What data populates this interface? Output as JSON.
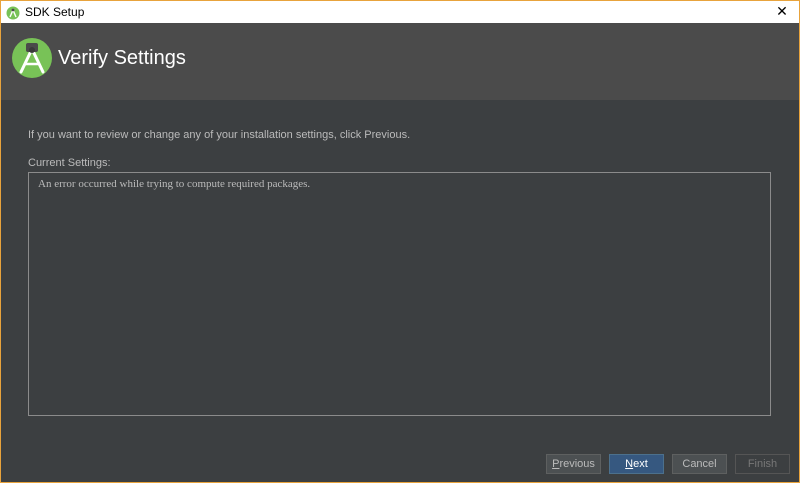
{
  "window": {
    "title": "SDK Setup",
    "close_glyph": "✕"
  },
  "header": {
    "heading": "Verify Settings"
  },
  "main": {
    "instructions": "If you want to review or change any of your installation settings, click Previous.",
    "settings_label": "Current Settings:",
    "settings_text": "An error occurred while trying to compute required packages."
  },
  "buttons": {
    "previous": {
      "mnemonic": "P",
      "rest": "revious"
    },
    "next": {
      "mnemonic": "N",
      "rest": "ext"
    },
    "cancel": "Cancel",
    "finish": "Finish"
  },
  "colors": {
    "background": "#3c3f41",
    "header": "#4b4b4b",
    "primary_button": "#365880",
    "logo_green": "#78c257"
  },
  "icons": {
    "app": "android-studio-icon",
    "logo": "android-studio-logo-icon",
    "close": "close-icon"
  }
}
